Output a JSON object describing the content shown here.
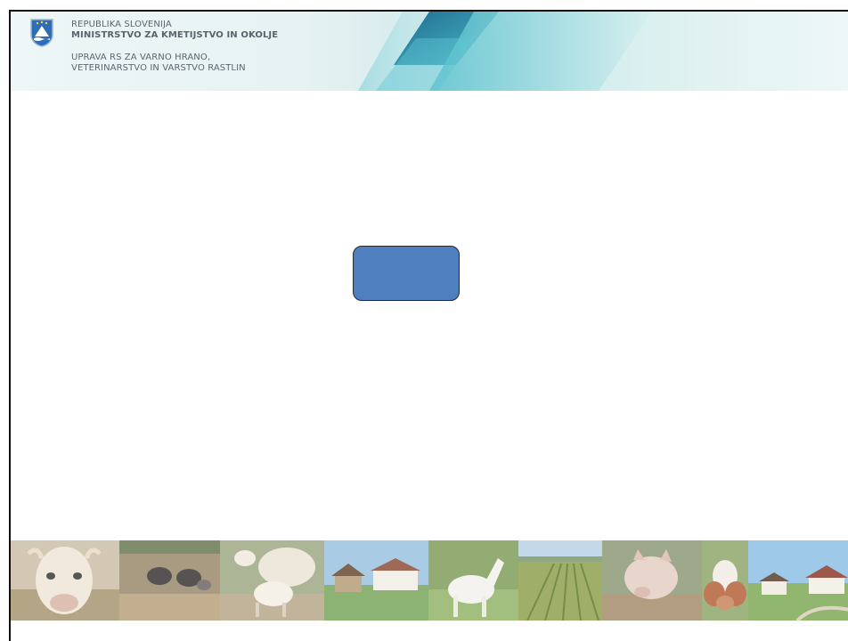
{
  "header": {
    "line1": "REPUBLIKA SLOVENIJA",
    "line2": "MINISTRSTVO ZA KMETIJSTVO IN OKOLJE",
    "line3": "UPRAVA RS ZA VARNO HRANO,",
    "line4": "VETERINARSTVO IN VARSTVO RASTLIN"
  },
  "colors": {
    "box_fill": "#4f7fbf",
    "header_accent": "#1a8fb0"
  },
  "photo_strip": {
    "photos": [
      "cow",
      "pigs",
      "sheep-with-lamb",
      "farmhouse",
      "white-horse",
      "crop-field",
      "pig",
      "calf",
      "village"
    ]
  }
}
